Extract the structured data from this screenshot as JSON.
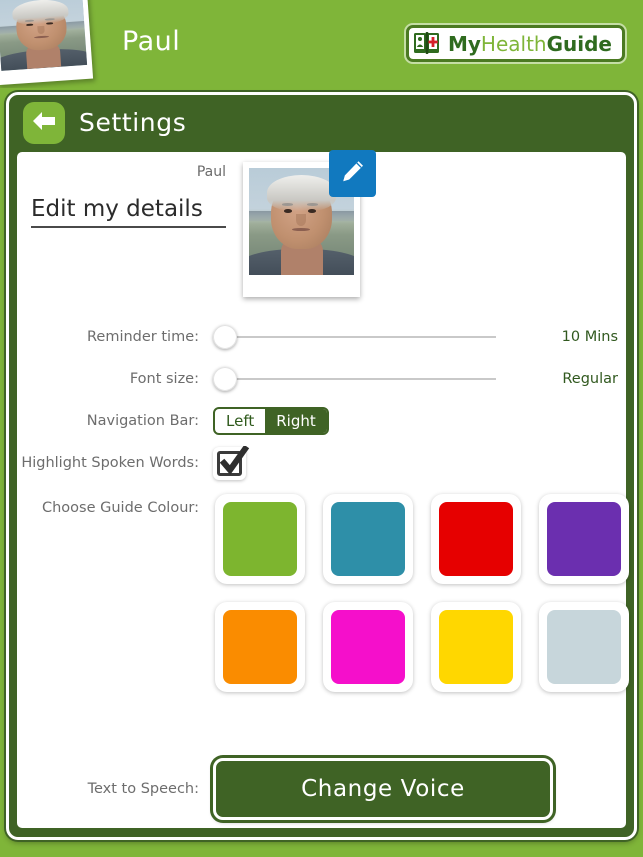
{
  "header": {
    "user_name": "Paul",
    "avatar_icon": "user-photo",
    "logo": {
      "icon": "health-book-icon",
      "part1": "My",
      "part2": "Health",
      "part3": "Guide"
    }
  },
  "panel": {
    "back_icon": "back-arrow-icon",
    "title": "Settings"
  },
  "details": {
    "name_label": "Paul",
    "edit_link": "Edit my details",
    "photo_icon": "user-photo",
    "edit_badge_icon": "pencil-icon"
  },
  "settings": {
    "reminder_time": {
      "label": "Reminder time:",
      "value": "10 Mins",
      "slider_position": 0
    },
    "font_size": {
      "label": "Font size:",
      "value": "Regular",
      "slider_position": 0
    },
    "navigation_bar": {
      "label": "Navigation Bar:",
      "options": [
        "Left",
        "Right"
      ],
      "selected": "Right"
    },
    "highlight_spoken_words": {
      "label": "Highlight Spoken Words:",
      "checked": true,
      "icon": "checkbox-checked-icon"
    },
    "guide_colour": {
      "label": "Choose Guide Colour:",
      "swatches": [
        {
          "name": "green",
          "hex": "#7DB52F"
        },
        {
          "name": "teal",
          "hex": "#2E8FA8"
        },
        {
          "name": "red",
          "hex": "#E60000"
        },
        {
          "name": "purple",
          "hex": "#6B2FAF"
        },
        {
          "name": "orange",
          "hex": "#FA8C00"
        },
        {
          "name": "magenta",
          "hex": "#F50FCB"
        },
        {
          "name": "yellow",
          "hex": "#FFD700"
        },
        {
          "name": "light-grey",
          "hex": "#C7D6DB"
        }
      ]
    },
    "text_to_speech": {
      "label": "Text to Speech:",
      "button_label": "Change Voice"
    }
  },
  "colors": {
    "brand_green": "#7fb539",
    "dark_green": "#3f6325",
    "accent_blue": "#1179bf"
  }
}
